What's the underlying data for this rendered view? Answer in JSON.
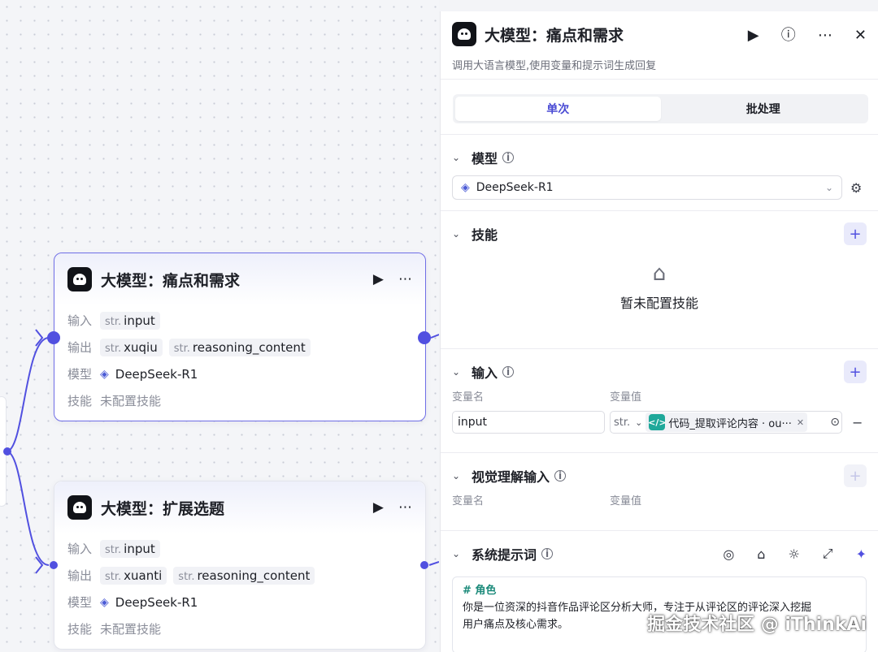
{
  "node1": {
    "title": "大模型：痛点和需求",
    "input_label": "输入",
    "output_label": "输出",
    "model_label": "模型",
    "skill_label": "技能",
    "inputs": [
      {
        "type": "str.",
        "name": "input"
      }
    ],
    "outputs": [
      {
        "type": "str.",
        "name": "xuqiu"
      },
      {
        "type": "str.",
        "name": "reasoning_content"
      }
    ],
    "model": "DeepSeek-R1",
    "skill": "未配置技能"
  },
  "node2": {
    "title": "大模型：扩展选题",
    "input_label": "输入",
    "output_label": "输出",
    "model_label": "模型",
    "skill_label": "技能",
    "inputs": [
      {
        "type": "str.",
        "name": "input"
      }
    ],
    "outputs": [
      {
        "type": "str.",
        "name": "xuanti"
      },
      {
        "type": "str.",
        "name": "reasoning_content"
      }
    ],
    "model": "DeepSeek-R1",
    "skill": "未配置技能"
  },
  "panel": {
    "title": "大模型：痛点和需求",
    "description": "调用大语言模型,使用变量和提示词生成回复",
    "tabs": [
      "单次",
      "批处理"
    ],
    "active_tab": 0,
    "model_section": {
      "title": "模型",
      "selected": "DeepSeek-R1"
    },
    "skills_section": {
      "title": "技能",
      "empty_text": "暂未配置技能"
    },
    "input_section": {
      "title": "输入",
      "col_name": "变量名",
      "col_value": "变量值",
      "rows": [
        {
          "name": "input",
          "type": "str.",
          "ref": "代码_提取评论内容 · ou···"
        }
      ]
    },
    "vision_section": {
      "title": "视觉理解输入",
      "col_name": "变量名",
      "col_value": "变量值"
    },
    "system_prompt": {
      "title": "系统提示词",
      "heading": "# 角色",
      "body_line1": "你是一位资深的抖音作品评论区分析大师，专注于从评论区的评论深入挖掘",
      "body_line2": "用户痛点及核心需求。"
    }
  },
  "watermark": "掘金技术社区 @ iThinkAi",
  "colors": {
    "accent": "#5150e0",
    "code_tag": "#1fa89a"
  }
}
